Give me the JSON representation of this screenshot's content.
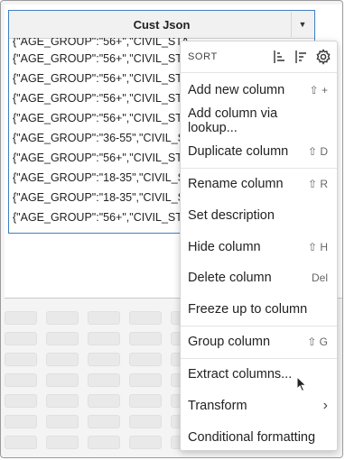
{
  "column": {
    "title": "Cust Json",
    "rows": [
      "{\"AGE_GROUP\":\"56+\",\"CIVIL_STA",
      "{\"AGE_GROUP\":\"56+\",\"CIVIL_STA",
      "{\"AGE_GROUP\":\"56+\",\"CIVIL_STA",
      "{\"AGE_GROUP\":\"56+\",\"CIVIL_STA",
      "{\"AGE_GROUP\":\"56+\",\"CIVIL_STA",
      "{\"AGE_GROUP\":\"36-55\",\"CIVIL_ST",
      "{\"AGE_GROUP\":\"56+\",\"CIVIL_STA",
      "{\"AGE_GROUP\":\"18-35\",\"CIVIL_ST",
      "{\"AGE_GROUP\":\"18-35\",\"CIVIL_ST",
      "{\"AGE_GROUP\":\"56+\",\"CIVIL_STA"
    ]
  },
  "menu": {
    "sort_label": "SORT",
    "items": [
      {
        "label": "Add new column",
        "shortcut": "⇧ +"
      },
      {
        "label": "Add column via lookup...",
        "shortcut": ""
      },
      {
        "label": "Duplicate column",
        "shortcut": "⇧ D"
      },
      {
        "label": "Rename column",
        "shortcut": "⇧ R"
      },
      {
        "label": "Set description",
        "shortcut": ""
      },
      {
        "label": "Hide column",
        "shortcut": "⇧ H"
      },
      {
        "label": "Delete column",
        "shortcut": "Del"
      },
      {
        "label": "Freeze up to column",
        "shortcut": ""
      },
      {
        "label": "Group column",
        "shortcut": "⇧ G"
      },
      {
        "label": "Extract columns...",
        "shortcut": ""
      },
      {
        "label": "Transform",
        "shortcut": ""
      },
      {
        "label": "Conditional formatting",
        "shortcut": ""
      }
    ]
  },
  "icons": {
    "sort_asc": "sort-ascending-icon",
    "sort_desc": "sort-descending-icon",
    "settings": "gear-icon",
    "dropdown": "chevron-down-icon",
    "submenu": "chevron-right-icon"
  },
  "colors": {
    "selection_border": "#3f7fbf",
    "menu_background": "#ffffff"
  }
}
